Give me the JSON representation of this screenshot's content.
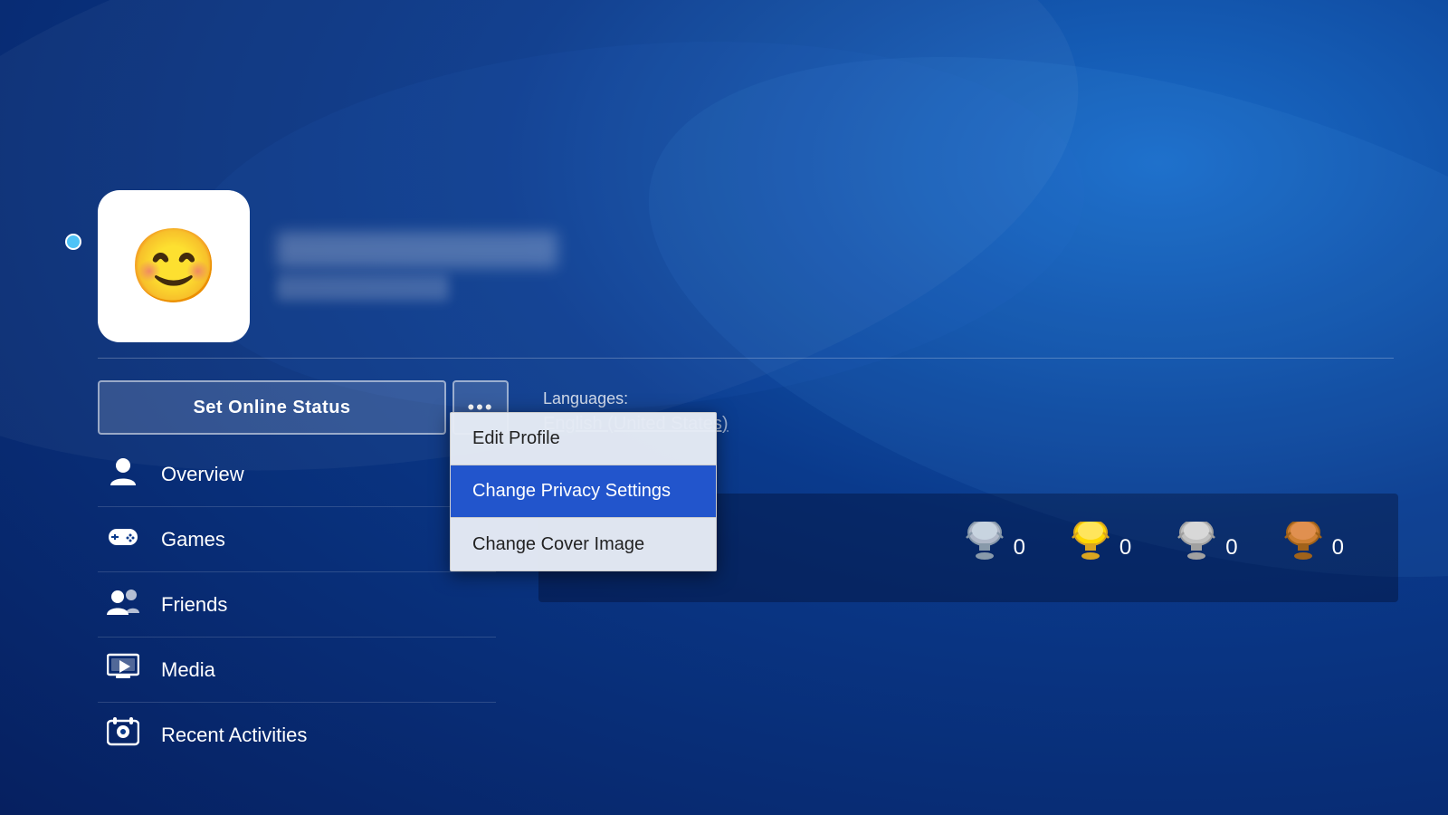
{
  "background": {
    "color_primary": "#0a3a8c",
    "color_secondary": "#062060"
  },
  "profile": {
    "avatar_emoji": "😊",
    "online_status": "online",
    "name_blurred": true,
    "sub_blurred": true
  },
  "buttons": {
    "set_online_status": "Set Online Status",
    "more_options": "•••"
  },
  "nav": {
    "items": [
      {
        "label": "Overview",
        "icon": "person"
      },
      {
        "label": "Games",
        "icon": "gamepad"
      },
      {
        "label": "Friends",
        "icon": "friends"
      },
      {
        "label": "Media",
        "icon": "media"
      },
      {
        "label": "Recent Activities",
        "icon": "recent"
      }
    ]
  },
  "right_panel": {
    "languages_label": "Languages:",
    "languages_value": "English (United States)"
  },
  "dropdown": {
    "items": [
      {
        "label": "Edit Profile",
        "highlighted": false
      },
      {
        "label": "Change Privacy Settings",
        "highlighted": true
      },
      {
        "label": "Change Cover Image",
        "highlighted": false
      }
    ]
  },
  "trophies": [
    {
      "type": "platinum",
      "count": "0",
      "color": "#aaa"
    },
    {
      "type": "gold",
      "count": "0",
      "color": "#FFD700"
    },
    {
      "type": "silver",
      "count": "0",
      "color": "#C0C0C0"
    },
    {
      "type": "bronze",
      "count": "0",
      "color": "#CD7F32"
    }
  ]
}
